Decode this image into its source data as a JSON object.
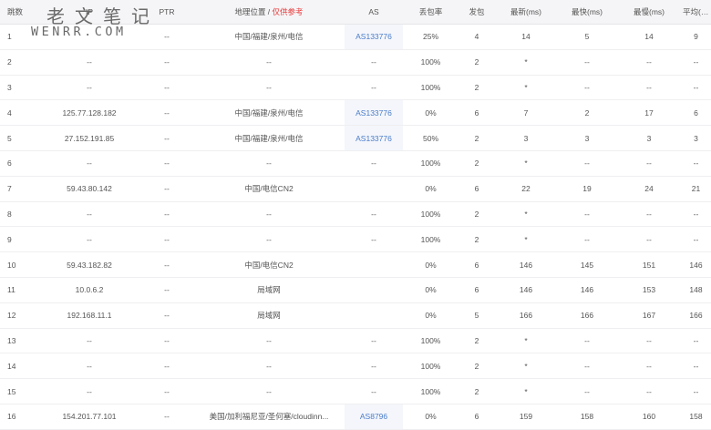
{
  "watermark": {
    "title": "老文笔记",
    "url": "WENRR.COM"
  },
  "table": {
    "headers": {
      "hop": "跳数",
      "ip": "IP",
      "ptr": "PTR",
      "geo": "地理位置 / ",
      "geo_note": "仅供参考",
      "as": "AS",
      "loss": "丢包率",
      "sent": "发包",
      "last": "最新(ms)",
      "best": "最快(ms)",
      "worst": "最慢(ms)",
      "avg": "平均(ms)"
    },
    "rows": [
      {
        "hop": "1",
        "ip": "",
        "ptr": "--",
        "geo": "中国/福建/泉州/电信",
        "as": "AS133776",
        "loss": "25%",
        "sent": "4",
        "last": "14",
        "best": "5",
        "worst": "14",
        "avg": "9"
      },
      {
        "hop": "2",
        "ip": "--",
        "ptr": "--",
        "geo": "--",
        "as": "--",
        "loss": "100%",
        "sent": "2",
        "last": "*",
        "best": "--",
        "worst": "--",
        "avg": "--"
      },
      {
        "hop": "3",
        "ip": "--",
        "ptr": "--",
        "geo": "--",
        "as": "--",
        "loss": "100%",
        "sent": "2",
        "last": "*",
        "best": "--",
        "worst": "--",
        "avg": "--"
      },
      {
        "hop": "4",
        "ip": "125.77.128.182",
        "ptr": "--",
        "geo": "中国/福建/泉州/电信",
        "as": "AS133776",
        "loss": "0%",
        "sent": "6",
        "last": "7",
        "best": "2",
        "worst": "17",
        "avg": "6"
      },
      {
        "hop": "5",
        "ip": "27.152.191.85",
        "ptr": "--",
        "geo": "中国/福建/泉州/电信",
        "as": "AS133776",
        "loss": "50%",
        "sent": "2",
        "last": "3",
        "best": "3",
        "worst": "3",
        "avg": "3"
      },
      {
        "hop": "6",
        "ip": "--",
        "ptr": "--",
        "geo": "--",
        "as": "--",
        "loss": "100%",
        "sent": "2",
        "last": "*",
        "best": "--",
        "worst": "--",
        "avg": "--"
      },
      {
        "hop": "7",
        "ip": "59.43.80.142",
        "ptr": "--",
        "geo": "中国/电信CN2",
        "as": "",
        "loss": "0%",
        "sent": "6",
        "last": "22",
        "best": "19",
        "worst": "24",
        "avg": "21"
      },
      {
        "hop": "8",
        "ip": "--",
        "ptr": "--",
        "geo": "--",
        "as": "--",
        "loss": "100%",
        "sent": "2",
        "last": "*",
        "best": "--",
        "worst": "--",
        "avg": "--"
      },
      {
        "hop": "9",
        "ip": "--",
        "ptr": "--",
        "geo": "--",
        "as": "--",
        "loss": "100%",
        "sent": "2",
        "last": "*",
        "best": "--",
        "worst": "--",
        "avg": "--"
      },
      {
        "hop": "10",
        "ip": "59.43.182.82",
        "ptr": "--",
        "geo": "中国/电信CN2",
        "as": "",
        "loss": "0%",
        "sent": "6",
        "last": "146",
        "best": "145",
        "worst": "151",
        "avg": "146"
      },
      {
        "hop": "11",
        "ip": "10.0.6.2",
        "ptr": "--",
        "geo": "局域网",
        "as": "",
        "loss": "0%",
        "sent": "6",
        "last": "146",
        "best": "146",
        "worst": "153",
        "avg": "148"
      },
      {
        "hop": "12",
        "ip": "192.168.11.1",
        "ptr": "--",
        "geo": "局域网",
        "as": "",
        "loss": "0%",
        "sent": "5",
        "last": "166",
        "best": "166",
        "worst": "167",
        "avg": "166"
      },
      {
        "hop": "13",
        "ip": "--",
        "ptr": "--",
        "geo": "--",
        "as": "--",
        "loss": "100%",
        "sent": "2",
        "last": "*",
        "best": "--",
        "worst": "--",
        "avg": "--"
      },
      {
        "hop": "14",
        "ip": "--",
        "ptr": "--",
        "geo": "--",
        "as": "--",
        "loss": "100%",
        "sent": "2",
        "last": "*",
        "best": "--",
        "worst": "--",
        "avg": "--"
      },
      {
        "hop": "15",
        "ip": "--",
        "ptr": "--",
        "geo": "--",
        "as": "--",
        "loss": "100%",
        "sent": "2",
        "last": "*",
        "best": "--",
        "worst": "--",
        "avg": "--"
      },
      {
        "hop": "16",
        "ip": "154.201.77.101",
        "ptr": "--",
        "geo": "美国/加利福尼亚/圣何塞/cloudinn...",
        "as": "AS8796",
        "loss": "0%",
        "sent": "6",
        "last": "159",
        "best": "158",
        "worst": "160",
        "avg": "158"
      }
    ]
  },
  "colors": {
    "header_bg": "#f5f5f7",
    "as_link": "#4a7cc9",
    "note": "#e83838",
    "as_cell_bg": "#f4f6fb"
  }
}
